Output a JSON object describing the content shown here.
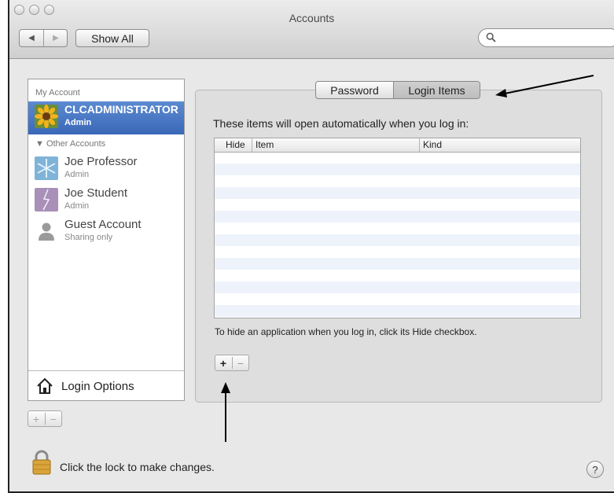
{
  "window": {
    "title": "Accounts"
  },
  "toolbar": {
    "back_glyph": "◀",
    "forward_glyph": "▶",
    "show_all_label": "Show All",
    "search_value": "",
    "search_placeholder": ""
  },
  "sidebar": {
    "my_account_label": "My Account",
    "my_account": {
      "name": "CLCADMINISTRATOR",
      "role": "Admin",
      "icon": "sunflower-avatar-icon"
    },
    "other_accounts_label": "▼ Other Accounts",
    "other_accounts": [
      {
        "name": "Joe Professor",
        "role": "Admin",
        "icon": "snowflake-avatar-icon"
      },
      {
        "name": "Joe Student",
        "role": "Admin",
        "icon": "lightning-avatar-icon"
      },
      {
        "name": "Guest Account",
        "role": "Sharing only",
        "icon": "guest-silhouette-icon"
      }
    ],
    "login_options_label": "Login Options",
    "add_glyph": "+",
    "remove_glyph": "−"
  },
  "main": {
    "tabs": [
      {
        "label": "Password"
      },
      {
        "label": "Login Items",
        "selected": true
      }
    ],
    "intro_text": "These items will open automatically when you log in:",
    "table": {
      "columns": [
        "Hide",
        "Item",
        "Kind"
      ],
      "rows": []
    },
    "hint_text": "To hide an application when you log in, click its Hide checkbox.",
    "add_glyph": "+",
    "remove_glyph": "−"
  },
  "footer": {
    "lock_text": "Click the lock to make changes.",
    "help_glyph": "?"
  },
  "colors": {
    "selection": "#3a68b8",
    "window_bg": "#e8e8e8",
    "stripe": "#eef3fb"
  }
}
